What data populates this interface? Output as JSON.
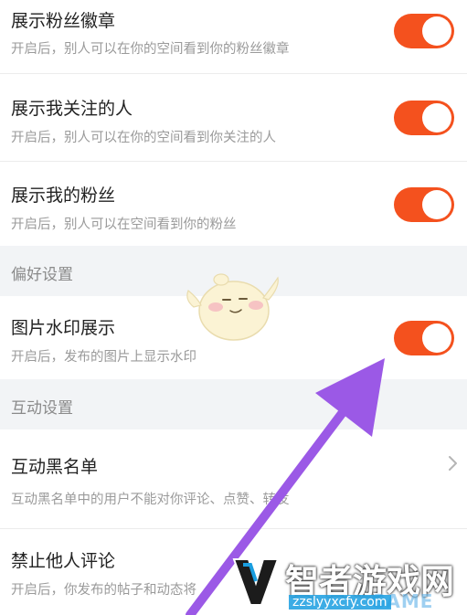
{
  "settings": {
    "show_fan_badge": {
      "title": "展示粉丝徽章",
      "desc": "开启后，别人可以在你的空间看到你的粉丝徽章",
      "enabled": true
    },
    "show_following": {
      "title": "展示我关注的人",
      "desc": "开启后，别人可以在你的空间看到你关注的人",
      "enabled": true
    },
    "show_fans": {
      "title": "展示我的粉丝",
      "desc": "开启后，别人可以在空间看到你的粉丝",
      "enabled": true
    }
  },
  "sections": {
    "preferences": {
      "label": "偏好设置"
    },
    "interaction": {
      "label": "互动设置"
    }
  },
  "preferences": {
    "image_watermark": {
      "title": "图片水印展示",
      "desc": "开启后，发布的图片上显示水印",
      "enabled": true
    }
  },
  "interaction": {
    "blacklist": {
      "title": "互动黑名单",
      "desc": "互动黑名单中的用户不能对你评论、点赞、转发"
    },
    "disable_comments": {
      "title": "禁止他人评论",
      "desc": "开启后，你发布的帖子和动态将"
    }
  },
  "watermark": {
    "brand": "智者游戏网",
    "url": "zzslyyxcfy.com",
    "overlay_text": "GAME"
  },
  "colors": {
    "toggle_on": "#f4511e",
    "section_bg": "#f2f4f6",
    "arrow": "#9b59e6"
  }
}
